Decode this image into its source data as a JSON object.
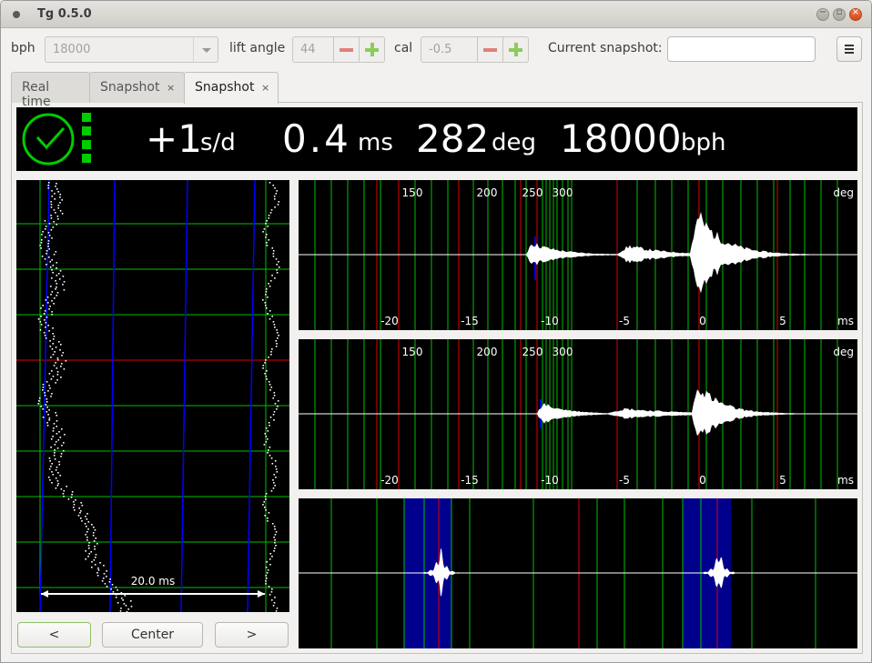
{
  "window": {
    "title": "Tg 0.5.0"
  },
  "toolbar": {
    "bph_label": "bph",
    "bph_value": "18000",
    "lift_angle_label": "lift angle",
    "lift_angle_value": "44",
    "cal_label": "cal",
    "cal_value": "-0.5",
    "current_snapshot_label": "Current snapshot:",
    "current_snapshot_value": ""
  },
  "tabs": [
    {
      "label": "Real time",
      "closable": false,
      "active": false
    },
    {
      "label": "Snapshot",
      "closable": true,
      "active": false
    },
    {
      "label": "Snapshot",
      "closable": true,
      "active": true
    }
  ],
  "tab_close_glyph": "×",
  "status": {
    "rate_value": "+1",
    "rate_unit": "s/d",
    "beat_error_value": "0.4",
    "beat_error_unit": "ms",
    "amplitude_value": "282",
    "amplitude_unit": "deg",
    "bph_value": "18000",
    "bph_unit": "bph",
    "icon": "clock-check-icon",
    "signal_bars": 4,
    "accent": "#00cc00"
  },
  "paperstrip": {
    "scale_label": "20.0 ms"
  },
  "waveform_top": {
    "deg_ticks": [
      "150",
      "200",
      "250",
      "300"
    ],
    "deg_unit": "deg",
    "ms_ticks": [
      "-20",
      "-15",
      "-10",
      "-5",
      "0",
      "5"
    ],
    "ms_unit": "ms"
  },
  "waveform_mid": {
    "deg_ticks": [
      "150",
      "200",
      "250",
      "300"
    ],
    "deg_unit": "deg",
    "ms_ticks": [
      "-20",
      "-15",
      "-10",
      "-5",
      "0",
      "5"
    ],
    "ms_unit": "ms"
  },
  "nav": {
    "prev": "<",
    "center": "Center",
    "next": ">"
  },
  "colors": {
    "grid_green": "#00c000",
    "grid_red": "#e00000",
    "trace_blue": "#0000ff",
    "highlight_blue": "#00008c"
  }
}
